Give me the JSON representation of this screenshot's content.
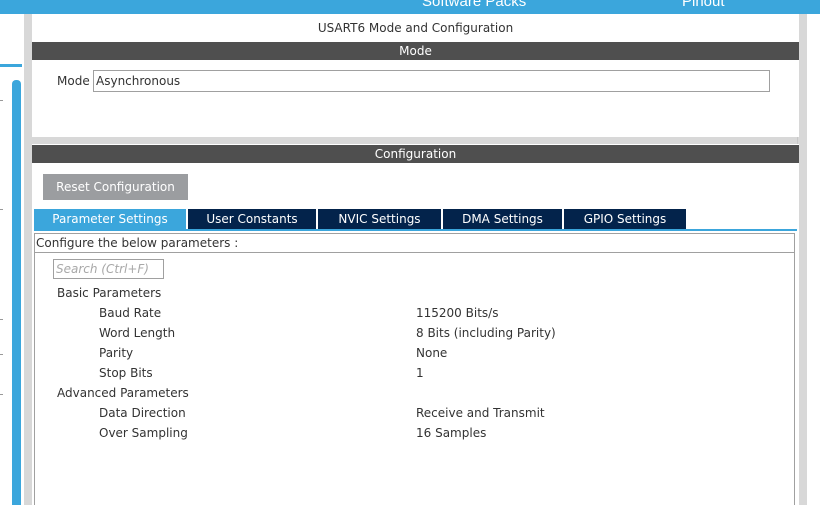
{
  "banner": {
    "software_packs": "Software Packs",
    "pinout": "Pinout"
  },
  "panel": {
    "title": "USART6 Mode and Configuration"
  },
  "mode_section": {
    "header": "Mode",
    "mode_label": "Mode",
    "mode_value": "Asynchronous"
  },
  "config_section": {
    "header": "Configuration",
    "reset_button": "Reset Configuration",
    "tabs": [
      {
        "label": "Parameter Settings",
        "active": true
      },
      {
        "label": "User Constants",
        "active": false
      },
      {
        "label": "NVIC Settings",
        "active": false
      },
      {
        "label": "DMA Settings",
        "active": false
      },
      {
        "label": "GPIO Settings",
        "active": false
      }
    ],
    "caption": "Configure the below parameters :",
    "search_placeholder": "Search (Ctrl+F)"
  },
  "parameters": {
    "basic_group": "Basic Parameters",
    "advanced_group": "Advanced Parameters",
    "baud_rate": {
      "label": "Baud Rate",
      "value": "115200 Bits/s"
    },
    "word_length": {
      "label": "Word Length",
      "value": "8 Bits (including Parity)"
    },
    "parity": {
      "label": "Parity",
      "value": "None"
    },
    "stop_bits": {
      "label": "Stop Bits",
      "value": "1"
    },
    "data_direction": {
      "label": "Data Direction",
      "value": "Receive and Transmit"
    },
    "over_sampling": {
      "label": "Over Sampling",
      "value": "16 Samples"
    }
  },
  "colors": {
    "accent": "#3ba6dc",
    "tab_inactive": "#03234b",
    "section_header": "#4f4f4f",
    "reset_button": "#9b9da0"
  }
}
